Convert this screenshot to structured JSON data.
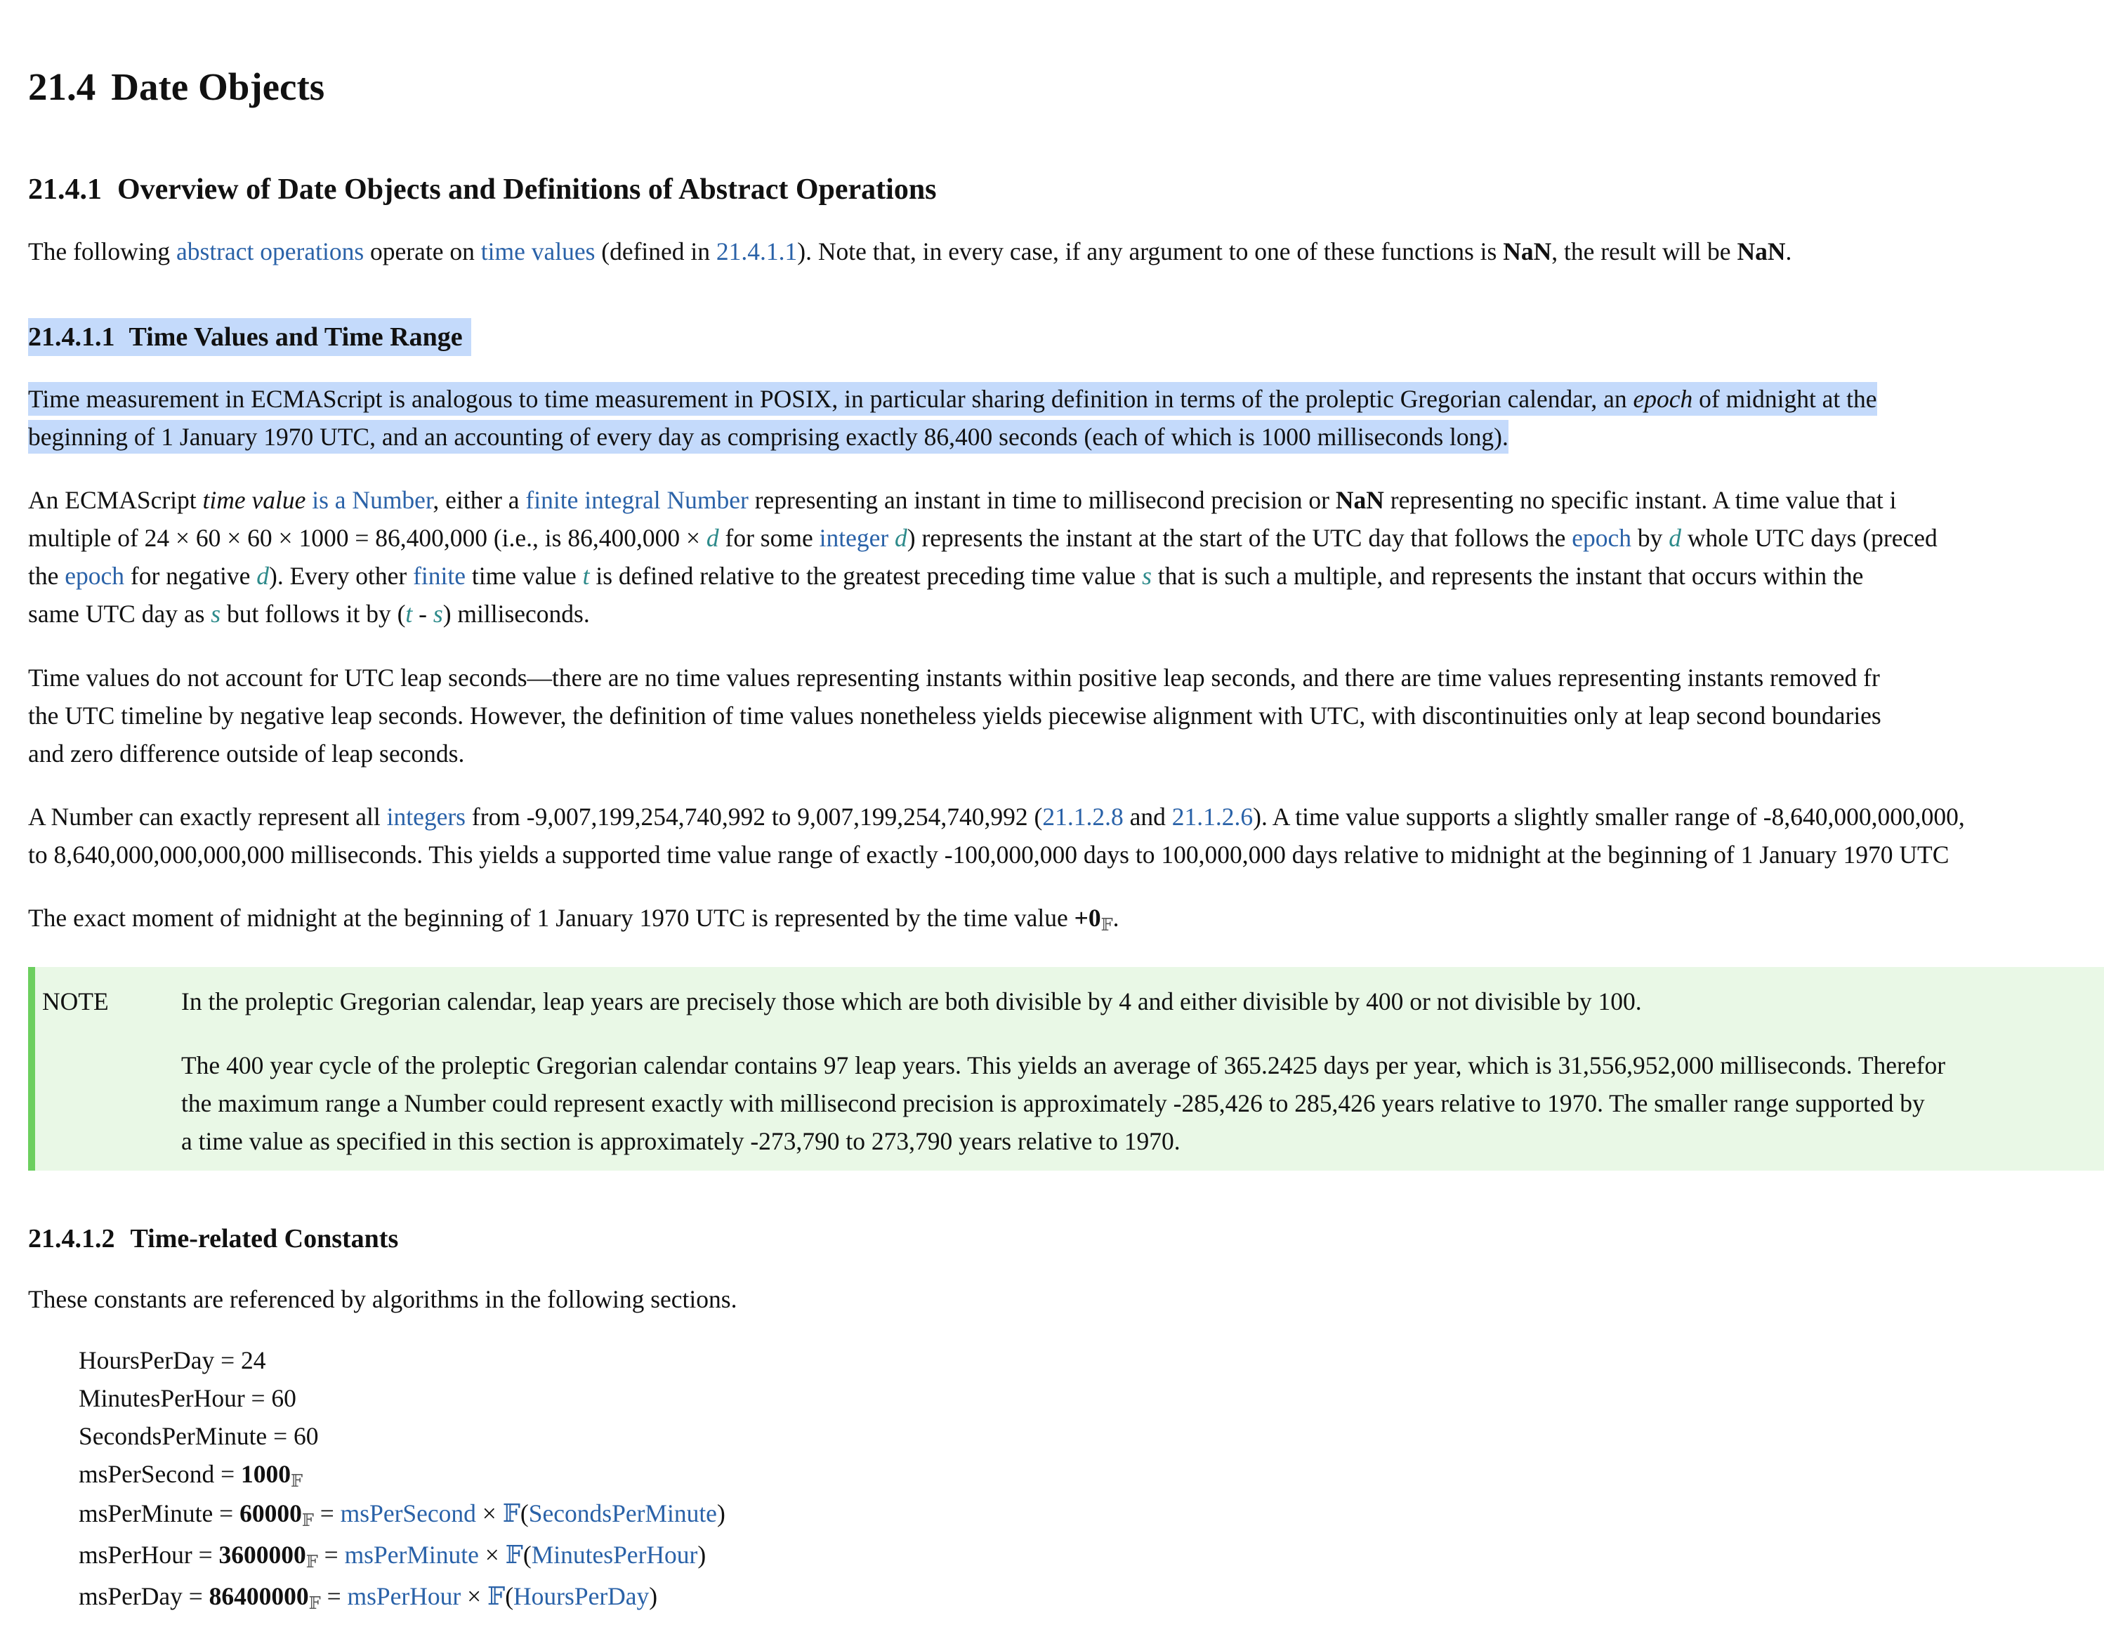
{
  "h1": {
    "num": "21.4",
    "title": "Date Objects"
  },
  "h2": {
    "num": "21.4.1",
    "title": "Overview of Date Objects and Definitions of Abstract Operations"
  },
  "intro": {
    "t1": "The following ",
    "l1": "abstract operations",
    "t2": " operate on ",
    "l2": "time values",
    "t3": " (defined in ",
    "l3": "21.4.1.1",
    "t4": "). Note that, in every case, if any argument to one of these functions is ",
    "b1": "NaN",
    "t5": ", the result will be ",
    "b2": "NaN",
    "t6": "."
  },
  "h3a": {
    "num": "21.4.1.1",
    "title": "Time Values and Time Range"
  },
  "p1": {
    "l1a": "Time measurement in ECMAScript is analogous to time measurement in POSIX, in particular sharing definition in terms of the proleptic Gregorian calendar, an ",
    "l1em": "epoch",
    "l1b": " of midnight at the",
    "l2": "beginning of 1 January 1970 UTC, and an accounting of every day as comprising exactly 86,400 seconds (each of which is 1000 milliseconds long)."
  },
  "p2": {
    "a1": "An ECMAScript ",
    "a2": "time value",
    "a3": " ",
    "a4": "is a Number",
    "a5": ", either a ",
    "a6": "finite integral Number",
    "a7": " representing an instant in time to millisecond precision or ",
    "a8": "NaN",
    "a9": " representing no specific instant. A time value that i",
    "b1": "multiple of 24 × 60 × 60 × 1000 = 86,400,000 (i.e., is 86,400,000 × ",
    "b2": "d",
    "b3": " for some ",
    "b4": "integer",
    "b5": " ",
    "b6": "d",
    "b7": ") represents the instant at the start of the UTC day that follows the ",
    "b8": "epoch",
    "b9": " by ",
    "b10": "d",
    "b11": " whole UTC days (preced",
    "c1": "the ",
    "c2": "epoch",
    "c3": " for negative ",
    "c4": "d",
    "c5": "). Every other ",
    "c6": "finite",
    "c7": " time value ",
    "c8": "t",
    "c9": " is defined relative to the greatest preceding time value ",
    "c10": "s",
    "c11": " that is such a multiple, and represents the instant that occurs within the",
    "d1": "same UTC day as ",
    "d2": "s",
    "d3": " but follows it by (",
    "d4": "t",
    "d5": " - ",
    "d6": "s",
    "d7": ") milliseconds."
  },
  "p3": {
    "l1": "Time values do not account for UTC leap seconds—there are no time values representing instants within positive leap seconds, and there are time values representing instants removed fr",
    "l2": "the UTC timeline by negative leap seconds. However, the definition of time values nonetheless yields piecewise alignment with UTC, with discontinuities only at leap second boundaries",
    "l3": "and zero difference outside of leap seconds."
  },
  "p4": {
    "a1": "A Number can exactly represent all ",
    "a2": "integers",
    "a3": " from -9,007,199,254,740,992 to 9,007,199,254,740,992 (",
    "a4": "21.1.2.8",
    "a5": " and ",
    "a6": "21.1.2.6",
    "a7": "). A time value supports a slightly smaller range of -8,640,000,000,000,",
    "b1": "to 8,640,000,000,000,000 milliseconds. This yields a supported time value range of exactly -100,000,000 days to 100,000,000 days relative to midnight at the beginning of 1 January 1970 UTC"
  },
  "p5": {
    "a1": "The exact moment of midnight at the beginning of 1 January 1970 UTC is represented by the time value ",
    "a2": "+0",
    "a3": "𝔽",
    "a4": "."
  },
  "note": {
    "label": "NOTE",
    "p1": "In the proleptic Gregorian calendar, leap years are precisely those which are both divisible by 4 and either divisible by 400 or not divisible by 100.",
    "p2l1": "The 400 year cycle of the proleptic Gregorian calendar contains 97 leap years. This yields an average of 365.2425 days per year, which is 31,556,952,000 milliseconds. Therefor",
    "p2l2": "the maximum range a Number could represent exactly with millisecond precision is approximately -285,426 to 285,426 years relative to 1970. The smaller range supported by",
    "p2l3": "a time value as specified in this section is approximately -273,790 to 273,790 years relative to 1970."
  },
  "h3b": {
    "num": "21.4.1.2",
    "title": "Time-related Constants"
  },
  "constants_intro": "These constants are referenced by algorithms in the following sections.",
  "constants": {
    "hpd": "HoursPerDay = 24",
    "mph": "MinutesPerHour = 60",
    "spm": "SecondsPerMinute = 60",
    "mps_a": "msPerSecond = ",
    "mps_b": "1000",
    "f": "𝔽",
    "mpm_a": "msPerMinute = ",
    "mpm_b": "60000",
    "mpm_c": " = ",
    "mpm_d": "msPerSecond",
    "mpm_e": " × ",
    "mpm_f": "𝔽",
    "mpm_g": "(",
    "mpm_h": "SecondsPerMinute",
    "mpm_i": ")",
    "mphr_a": "msPerHour = ",
    "mphr_b": "3600000",
    "mphr_d": "msPerMinute",
    "mphr_h": "MinutesPerHour",
    "mpd_a": "msPerDay = ",
    "mpd_b": "86400000",
    "mpd_d": "msPerHour",
    "mpd_h": "HoursPerDay"
  }
}
